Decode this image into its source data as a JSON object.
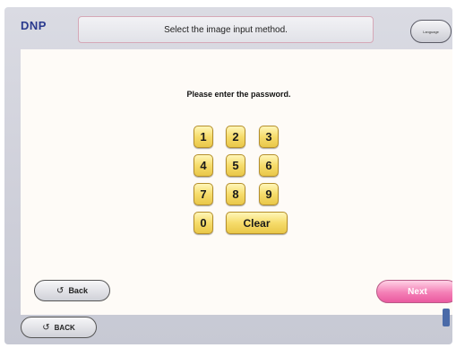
{
  "header": {
    "logo": "DNP",
    "title": "Select the image input method.",
    "language_label": "Language"
  },
  "main": {
    "prompt": "Please enter the password.",
    "keys": {
      "k1": "1",
      "k2": "2",
      "k3": "3",
      "k4": "4",
      "k5": "5",
      "k6": "6",
      "k7": "7",
      "k8": "8",
      "k9": "9",
      "k0": "0",
      "clear": "Clear"
    },
    "back_label": "Back",
    "next_label": "Next"
  },
  "footer": {
    "back_label": "BACK"
  },
  "colors": {
    "key_fill": "#f6dc6b",
    "next_fill": "#f47fb6",
    "logo": "#2a3a8e"
  },
  "icons": {
    "back": "circular-arrow-icon"
  }
}
